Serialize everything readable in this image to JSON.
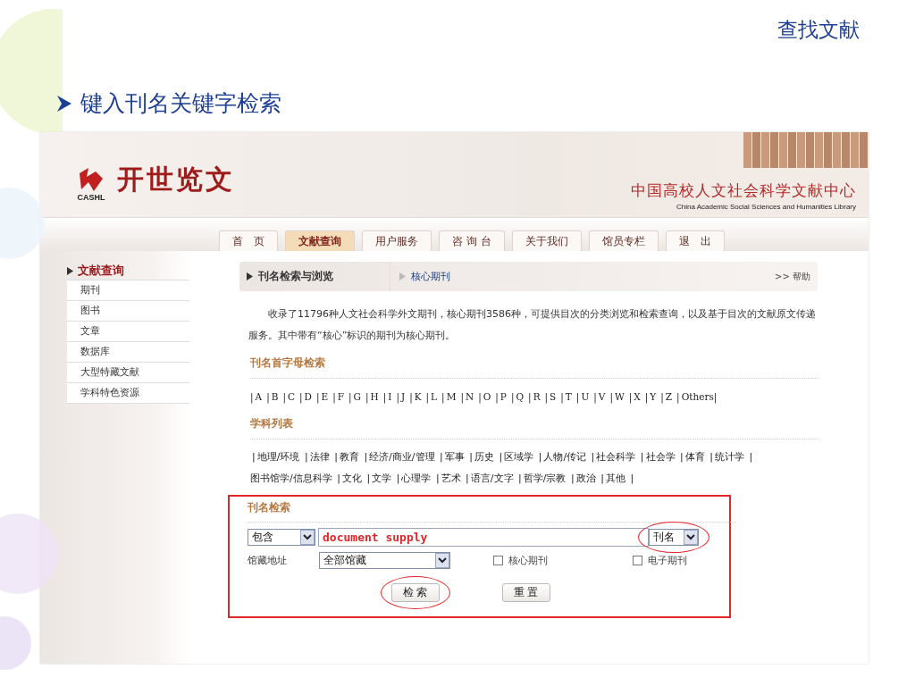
{
  "slide": {
    "title": "查找文献",
    "bullet": "键入刊名关键字检索"
  },
  "site": {
    "logo_text": "开世览文",
    "logo_caption": "CASHL",
    "org_name": "中国高校人文社会科学文献中心",
    "org_name_en": "China Academic Social Sciences and Humanities Library"
  },
  "nav": [
    {
      "label": "首　页",
      "selected": false
    },
    {
      "label": "文献查询",
      "selected": true
    },
    {
      "label": "用户服务",
      "selected": false
    },
    {
      "label": "咨 询 台",
      "selected": false
    },
    {
      "label": "关于我们",
      "selected": false
    },
    {
      "label": "馆员专栏",
      "selected": false
    },
    {
      "label": "退　出",
      "selected": false
    }
  ],
  "sidebar": {
    "heading": "文献查询",
    "items": [
      "期刊",
      "图书",
      "文章",
      "数据库",
      "大型特藏文献",
      "学科特色资源"
    ]
  },
  "breadcrumb": {
    "title": "刊名检索与浏览",
    "core": "核心期刊",
    "help": ">> 帮助"
  },
  "intro": "收录了11796种人文社会科学外文期刊，核心期刊3586种，可提供目次的分类浏览和检索查询，以及基于目次的文献原文传递服务。其中带有“核心”标识的期刊为核心期刊。",
  "letter_section": {
    "title": "刊名首字母检索",
    "separator": "|",
    "letters": [
      "A",
      "B",
      "C",
      "D",
      "E",
      "F",
      "G",
      "H",
      "I",
      "J",
      "K",
      "L",
      "M",
      "N",
      "O",
      "P",
      "Q",
      "R",
      "S",
      "T",
      "U",
      "V",
      "W",
      "X",
      "Y",
      "Z",
      "Others"
    ]
  },
  "subject_section": {
    "title": "学科列表",
    "separator": "|",
    "subjects": [
      "地理/环境",
      "法律",
      "教育",
      "经济/商业/管理",
      "军事",
      "历史",
      "区域学",
      "人物/传记",
      "社会科学",
      "社会学",
      "体育",
      "统计学",
      "图书馆学/信息科学",
      "文化",
      "文学",
      "心理学",
      "艺术",
      "语言/文字",
      "哲学/宗教",
      "政治",
      "其他"
    ]
  },
  "search": {
    "title": "刊名检索",
    "annotated": true,
    "match": "包含",
    "query": "document supply",
    "field": "刊名",
    "field_annotated": true,
    "location_label": "馆藏地址",
    "location": "全部馆藏",
    "checks": [
      {
        "label": "核心期刊",
        "checked": false
      },
      {
        "label": "电子期刊",
        "checked": false
      }
    ],
    "buttons": [
      {
        "label": "检 索",
        "annotated": true
      },
      {
        "label": "重 置",
        "annotated": false
      }
    ]
  }
}
